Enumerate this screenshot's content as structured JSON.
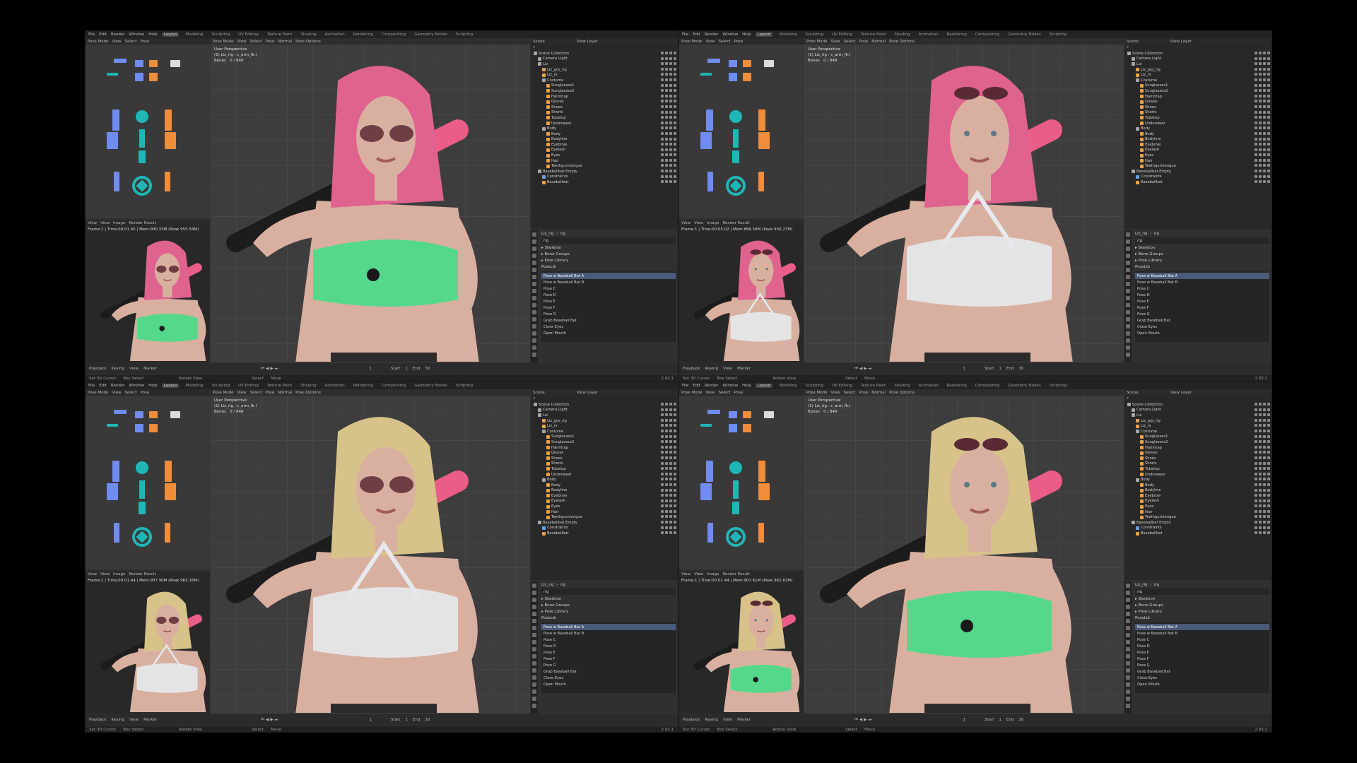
{
  "menu": [
    "File",
    "Edit",
    "Render",
    "Window",
    "Help"
  ],
  "workspaces": [
    "Layout",
    "Modeling",
    "Sculpting",
    "UV Editing",
    "Texture Paint",
    "Shading",
    "Animation",
    "Rendering",
    "Compositing",
    "Geometry Nodes",
    "Scripting"
  ],
  "active_workspace": "Layout",
  "scene_label": "Scene",
  "view_layer_label": "View Layer",
  "mode_label": "Pose Mode",
  "shading_label": "Normal",
  "pose_options": "Pose Options",
  "view_menu": [
    "View",
    "Select",
    "Pose"
  ],
  "image_menu": [
    "View",
    "View",
    "Image"
  ],
  "render_result": "Render Result",
  "viewport": {
    "title": "User Perspective",
    "object": "(1) Liz_rig : c_arm_fk.l",
    "bones": "Bones",
    "bones_count": "0 / 848"
  },
  "outliner": {
    "items": [
      {
        "label": "Scene Collection",
        "depth": 0,
        "icon": "collection"
      },
      {
        "label": "Camera Light",
        "depth": 1,
        "icon": "collection"
      },
      {
        "label": "Liz",
        "depth": 1,
        "icon": "collection"
      },
      {
        "label": "Liz_grp_rig",
        "depth": 2,
        "icon": "armature"
      },
      {
        "label": "Liz_rs",
        "depth": 2,
        "icon": "mesh"
      },
      {
        "label": "Costume",
        "depth": 2,
        "icon": "collection"
      },
      {
        "label": "Sunglasses1",
        "depth": 3,
        "icon": "mesh"
      },
      {
        "label": "Sunglasses2",
        "depth": 3,
        "icon": "mesh"
      },
      {
        "label": "Hairstrap",
        "depth": 3,
        "icon": "mesh"
      },
      {
        "label": "Gloves",
        "depth": 3,
        "icon": "mesh"
      },
      {
        "label": "Shoes",
        "depth": 3,
        "icon": "mesh"
      },
      {
        "label": "Shorts",
        "depth": 3,
        "icon": "mesh"
      },
      {
        "label": "Tubetop",
        "depth": 3,
        "icon": "mesh"
      },
      {
        "label": "Underwear",
        "depth": 3,
        "icon": "mesh"
      },
      {
        "label": "Body",
        "depth": 2,
        "icon": "collection"
      },
      {
        "label": "Body",
        "depth": 3,
        "icon": "mesh"
      },
      {
        "label": "Bodyline",
        "depth": 3,
        "icon": "mesh"
      },
      {
        "label": "Eyebrow",
        "depth": 3,
        "icon": "mesh"
      },
      {
        "label": "Eyelash",
        "depth": 3,
        "icon": "mesh"
      },
      {
        "label": "Eyes",
        "depth": 3,
        "icon": "mesh"
      },
      {
        "label": "Hair",
        "depth": 3,
        "icon": "mesh"
      },
      {
        "label": "Teethgumtongue",
        "depth": 3,
        "icon": "mesh"
      },
      {
        "label": "Baseballbat Empty",
        "depth": 1,
        "icon": "collection"
      },
      {
        "label": "Constraints",
        "depth": 2,
        "icon": "constraint"
      },
      {
        "label": "Baseballbat",
        "depth": 2,
        "icon": "mesh"
      }
    ]
  },
  "props": {
    "object": "Liz_rig",
    "data": "rig",
    "search": "rig",
    "sections": [
      "Skeleton",
      "Bone Groups",
      "Pose Library"
    ],
    "poselib": "PoseLib",
    "poses": [
      "Pose w Baseball Bat A",
      "Pose w Baseball Bat B",
      "Pose C",
      "Pose D",
      "Pose E",
      "Pose F",
      "Pose G",
      "Grab Baseball Bat",
      "Close Eyes",
      "Open Mouth"
    ]
  },
  "timeline": {
    "menu": [
      "Playback",
      "Keying",
      "View",
      "Marker"
    ],
    "frame": "1",
    "start_label": "Start",
    "start": "1",
    "end_label": "End",
    "end": "30"
  },
  "status": {
    "a": "Set 3D Cursor",
    "b": "Box Select",
    "c": "Rotate View",
    "d": "Select",
    "e": "Move",
    "version": "2.93.1"
  },
  "panels": [
    {
      "frame_info": "Frame:1 | Time:00:01.45 | Mem:900.33M (Peak 955.54M)",
      "hair": "#e0628f",
      "top": "green",
      "glasses": "on"
    },
    {
      "frame_info": "Frame:1 | Time:00:05.02 | Mem:866.58M (Peak 930.27M)",
      "hair": "#e0628f",
      "top": "white",
      "glasses": "head"
    },
    {
      "frame_info": "Frame:1 | Time:00:01.44 | Mem:907.90M (Peak 963.16M)",
      "hair": "#d7c28a",
      "top": "white",
      "glasses": "on"
    },
    {
      "frame_info": "Frame:1 | Time:00:01.44 | Mem:907.61M (Peak 962.82M)",
      "hair": "#d7c28a",
      "top": "green",
      "glasses": "head"
    }
  ],
  "colors": {
    "green_top": "#56d88c",
    "white_top": "#e6eaee",
    "skin": "#d9b0a0",
    "bat": "#ea5d86",
    "picker_blue": "#6f8cf0",
    "picker_cyan": "#1fb6b6",
    "picker_orange": "#f08c3a"
  }
}
